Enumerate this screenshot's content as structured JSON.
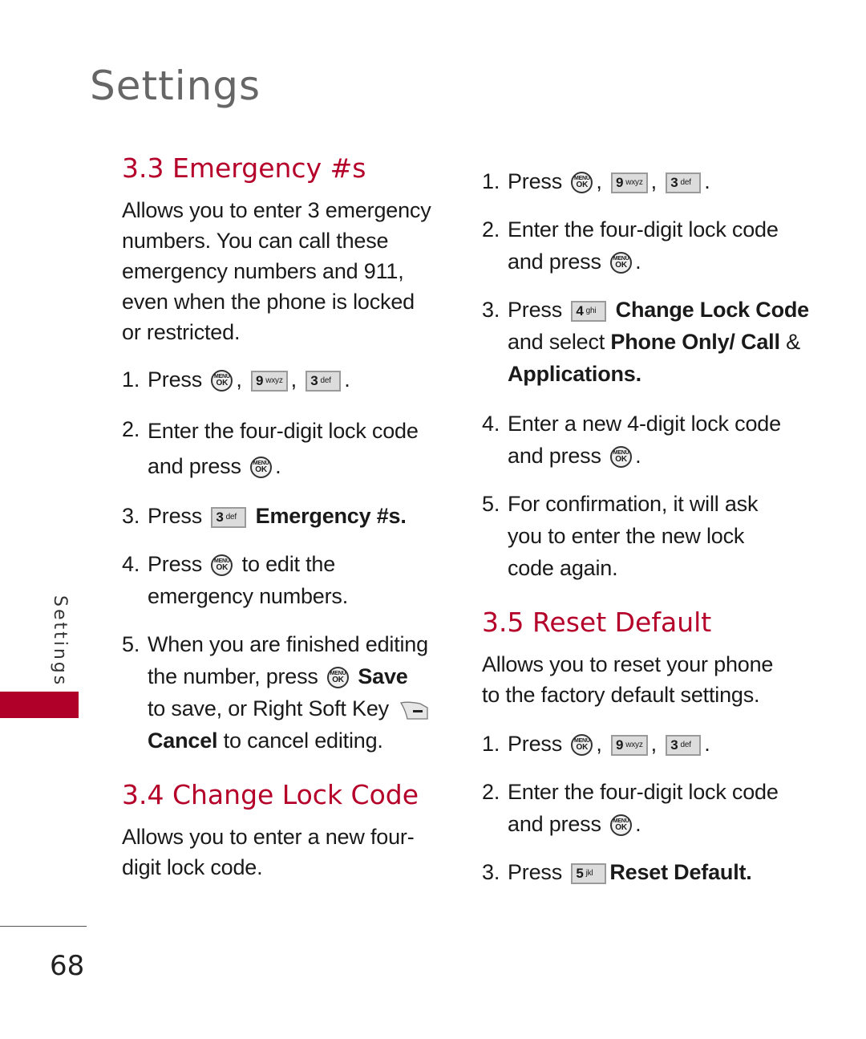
{
  "page": {
    "title": "Settings",
    "side_tab": "Settings",
    "page_number": "68",
    "accent_color": "#b0002a"
  },
  "icons": {
    "ok_key": {
      "name": "menu-ok-key-icon",
      "top": "MENU",
      "bottom": "OK"
    },
    "key_9": {
      "digit": "9",
      "letters": "wxyz"
    },
    "key_3": {
      "digit": "3",
      "letters": "def"
    },
    "key_4": {
      "digit": "4",
      "letters": "ghi"
    },
    "key_5": {
      "digit": "5",
      "letters": "jkl"
    },
    "right_soft_key": {
      "name": "right-soft-key-icon"
    }
  },
  "sections": {
    "emergency": {
      "heading": "3.3 Emergency #s",
      "description": "Allows you to enter 3 emergency numbers. You can call these emergency numbers and 911, even when the phone is locked or restricted.",
      "steps": [
        {
          "num": "1.",
          "pre": "Press",
          "sep1": ",",
          "sep2": ",",
          "end": "."
        },
        {
          "num": "2.",
          "pre": "Enter the four-digit lock code",
          "line2": "and press",
          "end": "."
        },
        {
          "num": "3.",
          "pre": "Press",
          "bold": "Emergency #s."
        },
        {
          "num": "4.",
          "pre": "Press",
          "post": "to edit the",
          "line2": "emergency numbers."
        },
        {
          "num": "5.",
          "pre": "When you are finished editing",
          "line2": "the number, press",
          "bold1": "Save",
          "line3": "to save, or Right Soft Key",
          "bold2": "Cancel",
          "line4": "to cancel editing."
        }
      ]
    },
    "change_lock": {
      "heading": "3.4 Change Lock Code",
      "description": "Allows you to enter a new four-digit lock code.",
      "steps": [
        {
          "num": "1.",
          "pre": "Press",
          "sep1": ",",
          "sep2": ",",
          "end": "."
        },
        {
          "num": "2.",
          "pre": "Enter the four-digit lock code",
          "line2": "and press",
          "end": "."
        },
        {
          "num": "3.",
          "pre": "Press",
          "bold1": "Change Lock Code",
          "mid": "and select",
          "bold2": "Phone Only/ Call",
          "amp": "&",
          "bold3": "Applications."
        },
        {
          "num": "4.",
          "pre": "Enter a new 4-digit lock code",
          "line2": "and press",
          "end": "."
        },
        {
          "num": "5.",
          "pre": "For confirmation, it will ask you to enter the new lock code again."
        }
      ]
    },
    "reset_default": {
      "heading": "3.5 Reset Default",
      "description": "Allows you to reset your phone to the factory default settings.",
      "steps": [
        {
          "num": "1.",
          "pre": "Press",
          "sep1": ",",
          "sep2": ",",
          "end": "."
        },
        {
          "num": "2.",
          "pre": "Enter the four-digit lock code",
          "line2": "and press",
          "end": "."
        },
        {
          "num": "3.",
          "pre": "Press",
          "bold": "Reset Default."
        }
      ]
    }
  }
}
